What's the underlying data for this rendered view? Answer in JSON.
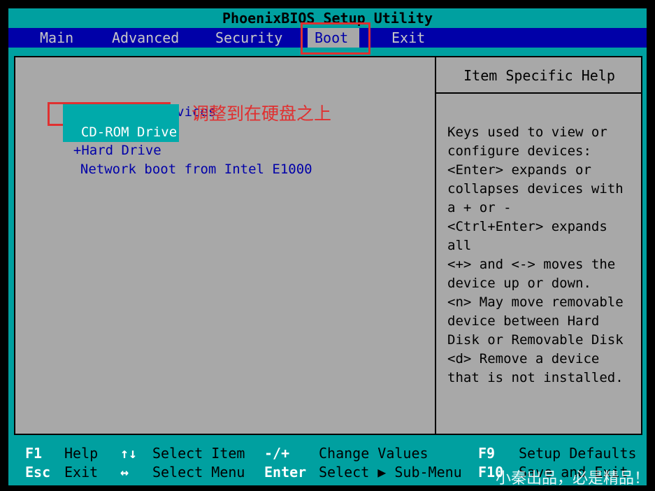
{
  "window": {
    "title": "PhoenixBIOS Setup Utility"
  },
  "menu": {
    "items": [
      "Main",
      "Advanced",
      "Security",
      "Boot",
      "Exit"
    ],
    "active": "Boot"
  },
  "boot_list": [
    {
      "prefix": "",
      "label": "Removable Devices"
    },
    {
      "prefix": "",
      "label": "CD-ROM Drive",
      "selected": true
    },
    {
      "prefix": "+",
      "label": "Hard Drive"
    },
    {
      "prefix": "",
      "label": "Network boot from Intel E1000"
    }
  ],
  "annotation": {
    "text": "调整到在硬盘之上"
  },
  "help": {
    "title": "Item Specific Help",
    "lines": [
      "Keys used to view or",
      "configure devices:",
      "<Enter> expands or",
      "collapses devices with",
      "a + or -",
      "<Ctrl+Enter> expands",
      "all",
      "<+> and <-> moves the",
      "device up or down.",
      "<n> May move removable",
      "device between Hard",
      "Disk or Removable Disk",
      "<d> Remove a device",
      "that is not installed."
    ]
  },
  "footer": {
    "row1": [
      {
        "key": "F1",
        "desc": "Help"
      },
      {
        "key": "↑↓",
        "desc": "Select Item"
      },
      {
        "key": "-/+",
        "desc": "Change Values"
      },
      {
        "key": "F9",
        "desc": "Setup Defaults"
      }
    ],
    "row2": [
      {
        "key": "Esc",
        "desc": "Exit"
      },
      {
        "key": "↔",
        "desc": "Select Menu"
      },
      {
        "key": "Enter",
        "desc": "Select ▶ Sub-Menu"
      },
      {
        "key": "F10",
        "desc": "Save and Exit"
      }
    ]
  },
  "watermark": {
    "text": "小秦出品，必是精品！"
  },
  "colors": {
    "menu_bg": "#0000a8",
    "frame_bg": "#00a0a0",
    "panel_bg": "#a8a8a8",
    "item_text": "#0000a8",
    "annotation": "#e03030"
  }
}
